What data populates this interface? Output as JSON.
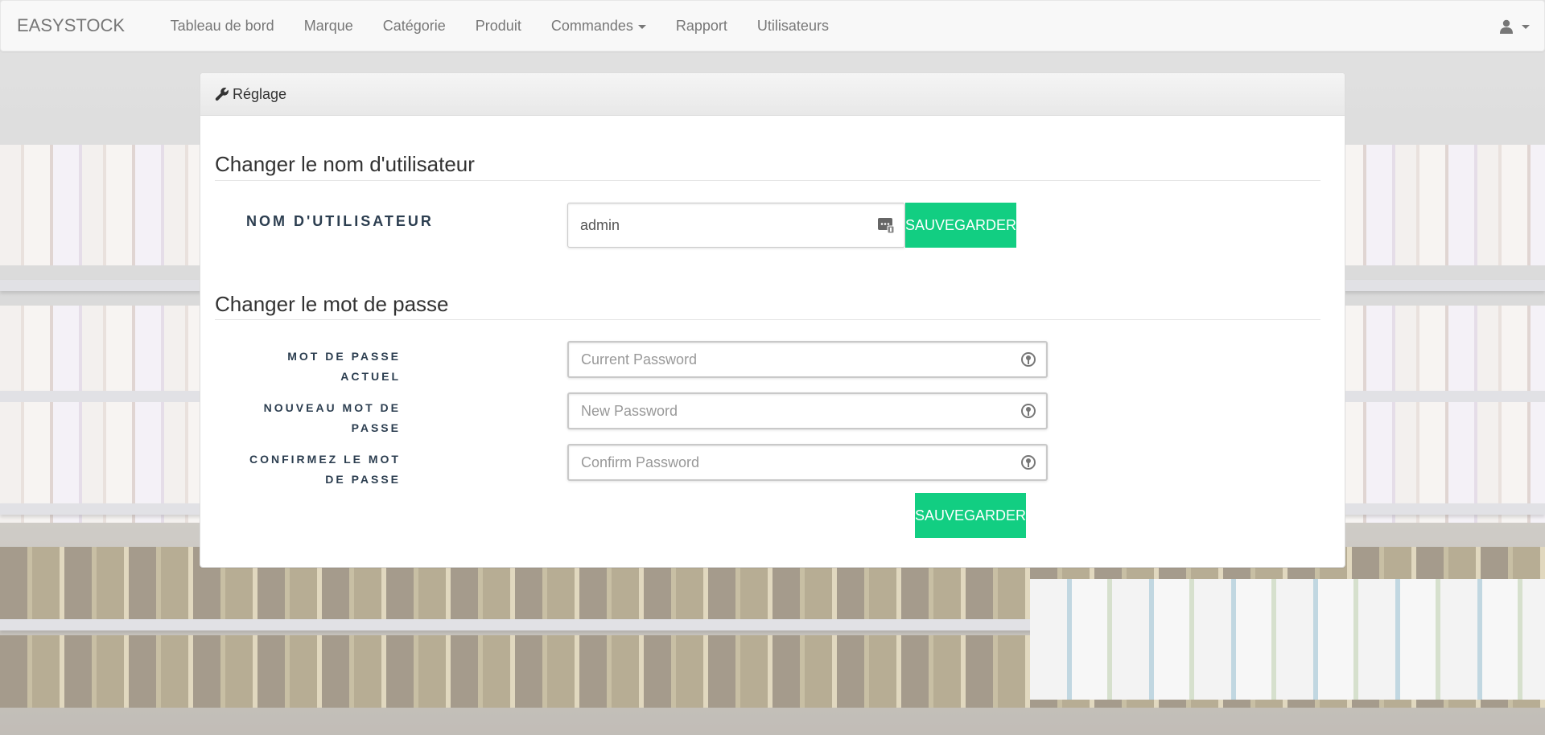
{
  "navbar": {
    "brand": "EASYSTOCK",
    "items": [
      {
        "label": "Tableau de bord"
      },
      {
        "label": "Marque"
      },
      {
        "label": "Catégorie"
      },
      {
        "label": "Produit"
      },
      {
        "label": "Commandes",
        "dropdown": true
      },
      {
        "label": "Rapport"
      },
      {
        "label": "Utilisateurs"
      }
    ],
    "user_icon": "user-icon"
  },
  "panel": {
    "heading": "Réglage",
    "heading_icon": "wrench-icon"
  },
  "username_section": {
    "title": "Changer le nom d'utilisateur",
    "label": "NOM D'UTILISATEUR",
    "value": "admin",
    "button": "SAUVEGARDER"
  },
  "password_section": {
    "title": "Changer le mot de passe",
    "current_label_1": "MOT DE PASSE",
    "current_label_2": "ACTUEL",
    "current_placeholder": "Current Password",
    "new_label_1": "NOUVEAU MOT DE",
    "new_label_2": "PASSE",
    "new_placeholder": "New Password",
    "confirm_label_1": "CONFIRMEZ LE MOT",
    "confirm_label_2": "DE PASSE",
    "confirm_placeholder": "Confirm Password",
    "button": "SAUVEGARDER"
  },
  "colors": {
    "accent_green": "#12ce82",
    "label_navy": "#2c3e50"
  }
}
